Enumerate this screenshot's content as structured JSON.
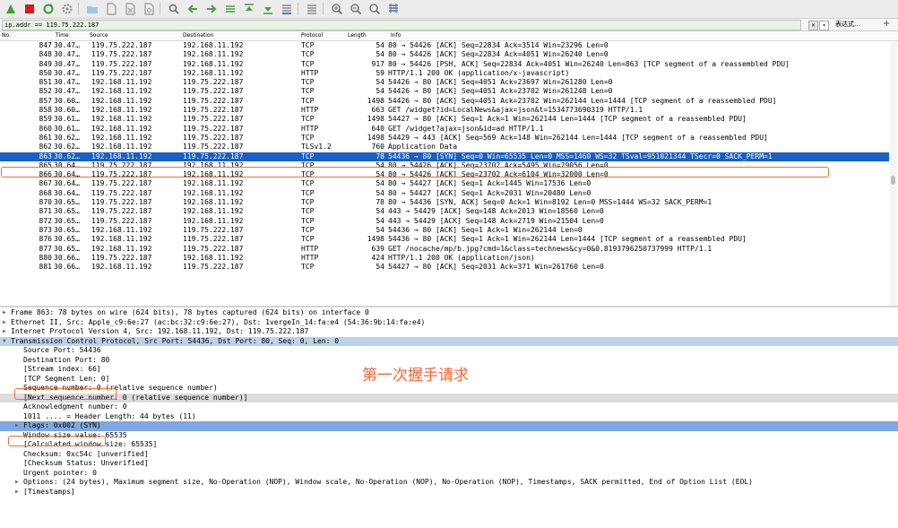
{
  "filter": {
    "value": "ip.addr == 119.75.222.187",
    "expression_label": "表达式…",
    "add_label": "+"
  },
  "toolbar": {
    "icons": [
      "shark-fin-start-icon",
      "stop-square-icon",
      "restart-icon",
      "capture-options-gear-icon",
      "open-folder-icon",
      "save-file-icon",
      "close-file-icon",
      "reload-icon",
      "find-magnifier-icon",
      "go-back-arrow-icon",
      "go-forward-arrow-icon",
      "go-to-packet-icon",
      "go-first-icon",
      "go-last-icon",
      "autoscroll-icon",
      "colorize-icon",
      "zoom-in-icon",
      "zoom-out-icon",
      "zoom-reset-icon",
      "resize-columns-icon"
    ],
    "colors": {
      "start": "#37a32b",
      "stop": "#d61b1b",
      "restart": "#3f9a33",
      "accent": "#1960c6"
    }
  },
  "columns": {
    "no": "No.",
    "time": "Time",
    "source": "Source",
    "destination": "Destination",
    "protocol": "Protocol",
    "length": "Length",
    "info": "Info"
  },
  "packets": [
    {
      "no": "847",
      "time": "30.47…",
      "src": "119.75.222.187",
      "dst": "192.168.11.192",
      "proto": "TCP",
      "len": "54",
      "info": "80 → 54426 [ACK] Seq=22834 Ack=3514 Win=23296 Len=0"
    },
    {
      "no": "848",
      "time": "30.47…",
      "src": "119.75.222.187",
      "dst": "192.168.11.192",
      "proto": "TCP",
      "len": "54",
      "info": "80 → 54426 [ACK] Seq=22834 Ack=4051 Win=26240 Len=0"
    },
    {
      "no": "849",
      "time": "30.47…",
      "src": "119.75.222.187",
      "dst": "192.168.11.192",
      "proto": "TCP",
      "len": "917",
      "info": "80 → 54426 [PSH, ACK] Seq=22834 Ack=4051 Win=26240 Len=863 [TCP segment of a reassembled PDU]"
    },
    {
      "no": "850",
      "time": "30.47…",
      "src": "119.75.222.187",
      "dst": "192.168.11.192",
      "proto": "HTTP",
      "len": "59",
      "info": "HTTP/1.1 200 OK  (application/x-javascript)"
    },
    {
      "no": "851",
      "time": "30.47…",
      "src": "192.168.11.192",
      "dst": "119.75.222.187",
      "proto": "TCP",
      "len": "54",
      "info": "54426 → 80 [ACK] Seq=4051 Ack=23697 Win=261280 Len=0"
    },
    {
      "no": "852",
      "time": "30.47…",
      "src": "192.168.11.192",
      "dst": "119.75.222.187",
      "proto": "TCP",
      "len": "54",
      "info": "54426 → 80 [ACK] Seq=4051 Ack=23702 Win=261248 Len=0"
    },
    {
      "no": "857",
      "time": "30.60…",
      "src": "192.168.11.192",
      "dst": "119.75.222.187",
      "proto": "TCP",
      "len": "1498",
      "info": "54426 → 80 [ACK] Seq=4051 Ack=23702 Win=262144 Len=1444 [TCP segment of a reassembled PDU]"
    },
    {
      "no": "858",
      "time": "30.60…",
      "src": "192.168.11.192",
      "dst": "119.75.222.187",
      "proto": "HTTP",
      "len": "663",
      "info": "GET /widget?id=LocalNews&ajax=json&t=1534773690319 HTTP/1.1"
    },
    {
      "no": "859",
      "time": "30.61…",
      "src": "192.168.11.192",
      "dst": "119.75.222.187",
      "proto": "TCP",
      "len": "1498",
      "info": "54427 → 80 [ACK] Seq=1 Ack=1 Win=262144 Len=1444 [TCP segment of a reassembled PDU]"
    },
    {
      "no": "860",
      "time": "30.61…",
      "src": "192.168.11.192",
      "dst": "119.75.222.187",
      "proto": "HTTP",
      "len": "640",
      "info": "GET /widget?ajax=json&id=ad HTTP/1.1"
    },
    {
      "no": "861",
      "time": "30.62…",
      "src": "192.168.11.192",
      "dst": "119.75.222.187",
      "proto": "TCP",
      "len": "1498",
      "info": "54429 → 443 [ACK] Seq=569 Ack=148 Win=262144 Len=1444 [TCP segment of a reassembled PDU]"
    },
    {
      "no": "862",
      "time": "30.62…",
      "src": "192.168.11.192",
      "dst": "119.75.222.187",
      "proto": "TLSv1.2",
      "len": "760",
      "info": "Application Data"
    },
    {
      "no": "863",
      "time": "30.62…",
      "src": "192.168.11.192",
      "dst": "119.75.222.187",
      "proto": "TCP",
      "len": "78",
      "info": "54436 → 80 [SYN] Seq=0 Win=65535 Len=0 MSS=1460 WS=32 TSval=951021344 TSecr=0 SACK_PERM=1",
      "selected": true
    },
    {
      "no": "865",
      "time": "30.64…",
      "src": "119.75.222.187",
      "dst": "192.168.11.192",
      "proto": "TCP",
      "len": "54",
      "info": "80 → 54426 [ACK] Seq=23702 Ack=5495 Win=29056 Len=0"
    },
    {
      "no": "866",
      "time": "30.64…",
      "src": "119.75.222.187",
      "dst": "192.168.11.192",
      "proto": "TCP",
      "len": "54",
      "info": "80 → 54426 [ACK] Seq=23702 Ack=6104 Win=32000 Len=0"
    },
    {
      "no": "867",
      "time": "30.64…",
      "src": "119.75.222.187",
      "dst": "192.168.11.192",
      "proto": "TCP",
      "len": "54",
      "info": "80 → 54427 [ACK] Seq=1 Ack=1445 Win=17536 Len=0"
    },
    {
      "no": "868",
      "time": "30.64…",
      "src": "119.75.222.187",
      "dst": "192.168.11.192",
      "proto": "TCP",
      "len": "54",
      "info": "80 → 54427 [ACK] Seq=1 Ack=2031 Win=20480 Len=0"
    },
    {
      "no": "870",
      "time": "30.65…",
      "src": "119.75.222.187",
      "dst": "192.168.11.192",
      "proto": "TCP",
      "len": "78",
      "info": "80 → 54436 [SYN, ACK] Seq=0 Ack=1 Win=8192 Len=0 MSS=1444 WS=32 SACK_PERM=1"
    },
    {
      "no": "871",
      "time": "30.65…",
      "src": "119.75.222.187",
      "dst": "192.168.11.192",
      "proto": "TCP",
      "len": "54",
      "info": "443 → 54429 [ACK] Seq=148 Ack=2013 Win=18560 Len=0"
    },
    {
      "no": "872",
      "time": "30.65…",
      "src": "119.75.222.187",
      "dst": "192.168.11.192",
      "proto": "TCP",
      "len": "54",
      "info": "443 → 54429 [ACK] Seq=148 Ack=2719 Win=21504 Len=0"
    },
    {
      "no": "873",
      "time": "30.65…",
      "src": "192.168.11.192",
      "dst": "119.75.222.187",
      "proto": "TCP",
      "len": "54",
      "info": "54436 → 80 [ACK] Seq=1 Ack=1 Win=262144 Len=0"
    },
    {
      "no": "876",
      "time": "30.65…",
      "src": "192.168.11.192",
      "dst": "119.75.222.187",
      "proto": "TCP",
      "len": "1498",
      "info": "54436 → 80 [ACK] Seq=1 Ack=1 Win=262144 Len=1444 [TCP segment of a reassembled PDU]"
    },
    {
      "no": "877",
      "time": "30.65…",
      "src": "192.168.11.192",
      "dst": "119.75.222.187",
      "proto": "HTTP",
      "len": "639",
      "info": "GET /nocache/mp/b.jpg?cmd=1&class=technews&cy=0&0.8193796250737999 HTTP/1.1"
    },
    {
      "no": "880",
      "time": "30.66…",
      "src": "119.75.222.187",
      "dst": "192.168.11.192",
      "proto": "HTTP",
      "len": "424",
      "info": "HTTP/1.1 200 OK  (application/json)"
    },
    {
      "no": "881",
      "time": "30.66…",
      "src": "192.168.11.192",
      "dst": "119.75.222.187",
      "proto": "TCP",
      "len": "54",
      "info": "54427 → 80 [ACK] Seq=2031 Ack=371 Win=261760 Len=0"
    }
  ],
  "details": [
    {
      "text": "Frame 863: 78 bytes on wire (624 bits), 78 bytes captured (624 bits) on interface 0",
      "indent": 0,
      "arrow": "▶"
    },
    {
      "text": "Ethernet II, Src: Apple_c9:6e:27 (ac:bc:32:c9:6e:27), Dst: 1vergeIn_14:fa:e4 (54:36:9b:14:fa:e4)",
      "indent": 0,
      "arrow": "▶"
    },
    {
      "text": "Internet Protocol Version 4, Src: 192.168.11.192, Dst: 119.75.222.187",
      "indent": 0,
      "arrow": "▶"
    },
    {
      "text": "Transmission Control Protocol, Src Port: 54436, Dst Port: 80, Seq: 0, Len: 0",
      "indent": 0,
      "arrow": "▼",
      "style": "hl"
    },
    {
      "text": "Source Port: 54436",
      "indent": 1
    },
    {
      "text": "Destination Port: 80",
      "indent": 1
    },
    {
      "text": "[Stream index: 66]",
      "indent": 1
    },
    {
      "text": "[TCP Segment Len: 0]",
      "indent": 1
    },
    {
      "text": "Sequence number: 0    (relative sequence number)",
      "indent": 1
    },
    {
      "text": "[Next sequence number: 0    (relative sequence number)]",
      "indent": 1,
      "style": "gray"
    },
    {
      "text": "Acknowledgment number: 0",
      "indent": 1
    },
    {
      "text": "1011 .... = Header Length: 44 bytes (11)",
      "indent": 1
    },
    {
      "text": "Flags: 0x002 (SYN)",
      "indent": 1,
      "arrow": "▶",
      "style": "flag"
    },
    {
      "text": "Window size value: 65535",
      "indent": 1
    },
    {
      "text": "[Calculated window size: 65535]",
      "indent": 1
    },
    {
      "text": "Checksum: 0xc54c [unverified]",
      "indent": 1
    },
    {
      "text": "[Checksum Status: Unverified]",
      "indent": 1
    },
    {
      "text": "Urgent pointer: 0",
      "indent": 1
    },
    {
      "text": "Options: (24 bytes), Maximum segment size, No-Operation (NOP), Window scale, No-Operation (NOP), No-Operation (NOP), Timestamps, SACK permitted, End of Option List (EOL)",
      "indent": 1,
      "arrow": "▶"
    },
    {
      "text": "[Timestamps]",
      "indent": 1,
      "arrow": "▶"
    }
  ],
  "annotation": "第一次握手请求",
  "annotation_color": "#f06a3c"
}
